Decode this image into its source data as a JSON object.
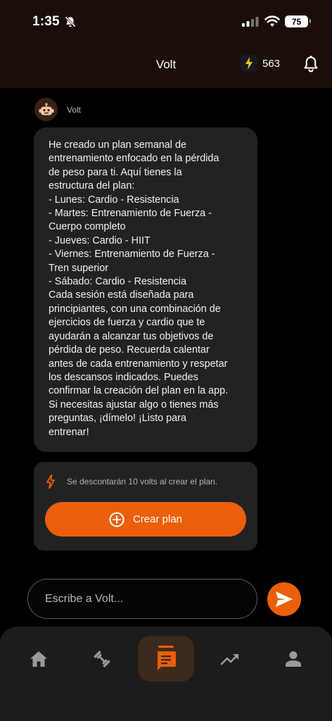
{
  "status_bar": {
    "time": "1:35",
    "battery": "75"
  },
  "header": {
    "title": "Volt",
    "volts_count": "563"
  },
  "chat": {
    "bot_name": "Volt",
    "message_lines": [
      "He creado un plan semanal de",
      "entrenamiento enfocado en la pérdida",
      "de peso para ti. Aquí tienes la",
      "estructura del plan:",
      "- Lunes: Cardio - Resistencia",
      "- Martes: Entrenamiento de Fuerza -",
      "Cuerpo completo",
      "- Jueves: Cardio - HIIT",
      "- Viernes: Entrenamiento de Fuerza -",
      "Tren superior",
      "- Sábado: Cardio - Resistencia",
      "Cada sesión está diseñada para",
      "principiantes, con una combinación de",
      "ejercicios de fuerza y cardio que te",
      "ayudarán a alcanzar tus objetivos de",
      "pérdida de peso. Recuerda calentar",
      "antes de cada entrenamiento y respetar",
      "los descansos indicados. Puedes",
      "confirmar la creación del plan en la app.",
      "Si necesitas ajustar algo o tienes más",
      "preguntas, ¡dímelo! ¡Listo para",
      "entrenar!"
    ]
  },
  "action_card": {
    "note": "Se descontarán 10 volts al crear el plan.",
    "button_label": "Crear plan"
  },
  "composer": {
    "placeholder": "Escribe a Volt..."
  },
  "nav": {
    "items": [
      "home",
      "workouts",
      "chat",
      "progress",
      "profile"
    ],
    "active": "chat"
  },
  "colors": {
    "accent": "#ec5f0a",
    "header_bg": "#1b0e08",
    "card_bg": "#222222",
    "nav_bg": "#1c1c1c",
    "bolt": "#f5c518"
  },
  "icons": {
    "status": [
      "bell-slash-icon",
      "cellular-signal-icon",
      "wifi-icon",
      "battery-icon"
    ],
    "header": [
      "lightning-bolt-icon",
      "bell-icon"
    ],
    "chat": [
      "robot-avatar-icon",
      "lightning-bolt-icon",
      "plus-circle-icon",
      "send-icon"
    ],
    "nav": [
      "home-icon",
      "dumbbell-icon",
      "chat-bubble-icon",
      "trending-up-icon",
      "person-icon"
    ]
  }
}
